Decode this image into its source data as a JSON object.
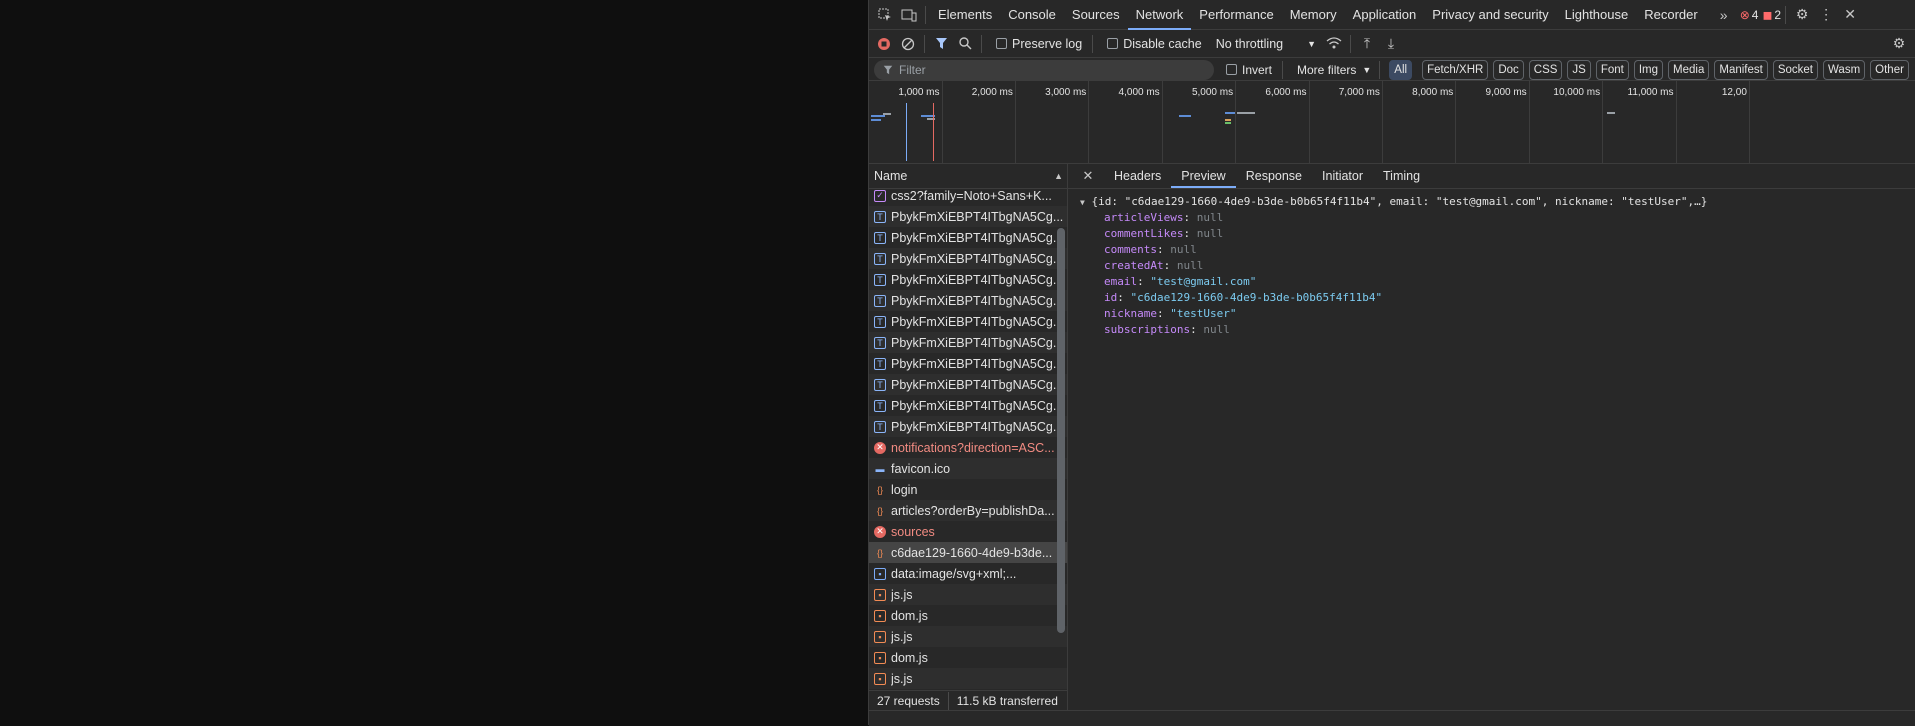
{
  "tabs": [
    "Elements",
    "Console",
    "Sources",
    "Network",
    "Performance",
    "Memory",
    "Application",
    "Privacy and security",
    "Lighthouse",
    "Recorder"
  ],
  "active_tab": "Network",
  "errors_count": "4",
  "warnings_count": "2",
  "toolbar": {
    "preserve_log": "Preserve log",
    "disable_cache": "Disable cache",
    "throttling": "No throttling"
  },
  "filter": {
    "placeholder": "Filter",
    "invert": "Invert",
    "more_filters": "More filters",
    "types": [
      "All",
      "Fetch/XHR",
      "Doc",
      "CSS",
      "JS",
      "Font",
      "Img",
      "Media",
      "Manifest",
      "Socket",
      "Wasm",
      "Other"
    ]
  },
  "timeline_ticks": [
    "1,000 ms",
    "2,000 ms",
    "3,000 ms",
    "4,000 ms",
    "5,000 ms",
    "6,000 ms",
    "7,000 ms",
    "8,000 ms",
    "9,000 ms",
    "10,000 ms",
    "11,000 ms",
    "12,00"
  ],
  "name_header": "Name",
  "requests": [
    {
      "name": "css2?family=Noto+Sans+K...",
      "type": "css"
    },
    {
      "name": "PbykFmXiEBPT4ITbgNA5Cg...",
      "type": "font"
    },
    {
      "name": "PbykFmXiEBPT4ITbgNA5Cg...",
      "type": "font"
    },
    {
      "name": "PbykFmXiEBPT4ITbgNA5Cg...",
      "type": "font"
    },
    {
      "name": "PbykFmXiEBPT4ITbgNA5Cg...",
      "type": "font"
    },
    {
      "name": "PbykFmXiEBPT4ITbgNA5Cg...",
      "type": "font"
    },
    {
      "name": "PbykFmXiEBPT4ITbgNA5Cg...",
      "type": "font"
    },
    {
      "name": "PbykFmXiEBPT4ITbgNA5Cg...",
      "type": "font"
    },
    {
      "name": "PbykFmXiEBPT4ITbgNA5Cg...",
      "type": "font"
    },
    {
      "name": "PbykFmXiEBPT4ITbgNA5Cg...",
      "type": "font"
    },
    {
      "name": "PbykFmXiEBPT4ITbgNA5Cg...",
      "type": "font"
    },
    {
      "name": "PbykFmXiEBPT4ITbgNA5Cg...",
      "type": "font"
    },
    {
      "name": "notifications?direction=ASC...",
      "type": "error"
    },
    {
      "name": "favicon.ico",
      "type": "img"
    },
    {
      "name": "login",
      "type": "xhr"
    },
    {
      "name": "articles?orderBy=publishDa...",
      "type": "xhr"
    },
    {
      "name": "sources",
      "type": "error"
    },
    {
      "name": "c6dae129-1660-4de9-b3de...",
      "type": "xhr",
      "selected": true
    },
    {
      "name": "data:image/svg+xml;...",
      "type": "doc"
    },
    {
      "name": "js.js",
      "type": "js"
    },
    {
      "name": "dom.js",
      "type": "js"
    },
    {
      "name": "js.js",
      "type": "js"
    },
    {
      "name": "dom.js",
      "type": "js"
    },
    {
      "name": "js.js",
      "type": "js"
    }
  ],
  "status": {
    "requests": "27 requests",
    "transferred": "11.5 kB transferred"
  },
  "detail_tabs": [
    "Headers",
    "Preview",
    "Response",
    "Initiator",
    "Timing"
  ],
  "active_detail_tab": "Preview",
  "preview": {
    "summary": "{id: \"c6dae129-1660-4de9-b3de-b0b65f4f11b4\", email: \"test@gmail.com\", nickname: \"testUser\",…}",
    "fields": [
      {
        "key": "articleViews",
        "value": "null",
        "kind": "null"
      },
      {
        "key": "commentLikes",
        "value": "null",
        "kind": "null"
      },
      {
        "key": "comments",
        "value": "null",
        "kind": "null"
      },
      {
        "key": "createdAt",
        "value": "null",
        "kind": "null"
      },
      {
        "key": "email",
        "value": "\"test@gmail.com\"",
        "kind": "string"
      },
      {
        "key": "id",
        "value": "\"c6dae129-1660-4de9-b3de-b0b65f4f11b4\"",
        "kind": "string"
      },
      {
        "key": "nickname",
        "value": "\"testUser\"",
        "kind": "string"
      },
      {
        "key": "subscriptions",
        "value": "null",
        "kind": "null"
      }
    ]
  },
  "colors": {
    "accent": "#7cacf8",
    "error": "#e46962",
    "panel": "#282828",
    "page": "#0f0f0f"
  }
}
